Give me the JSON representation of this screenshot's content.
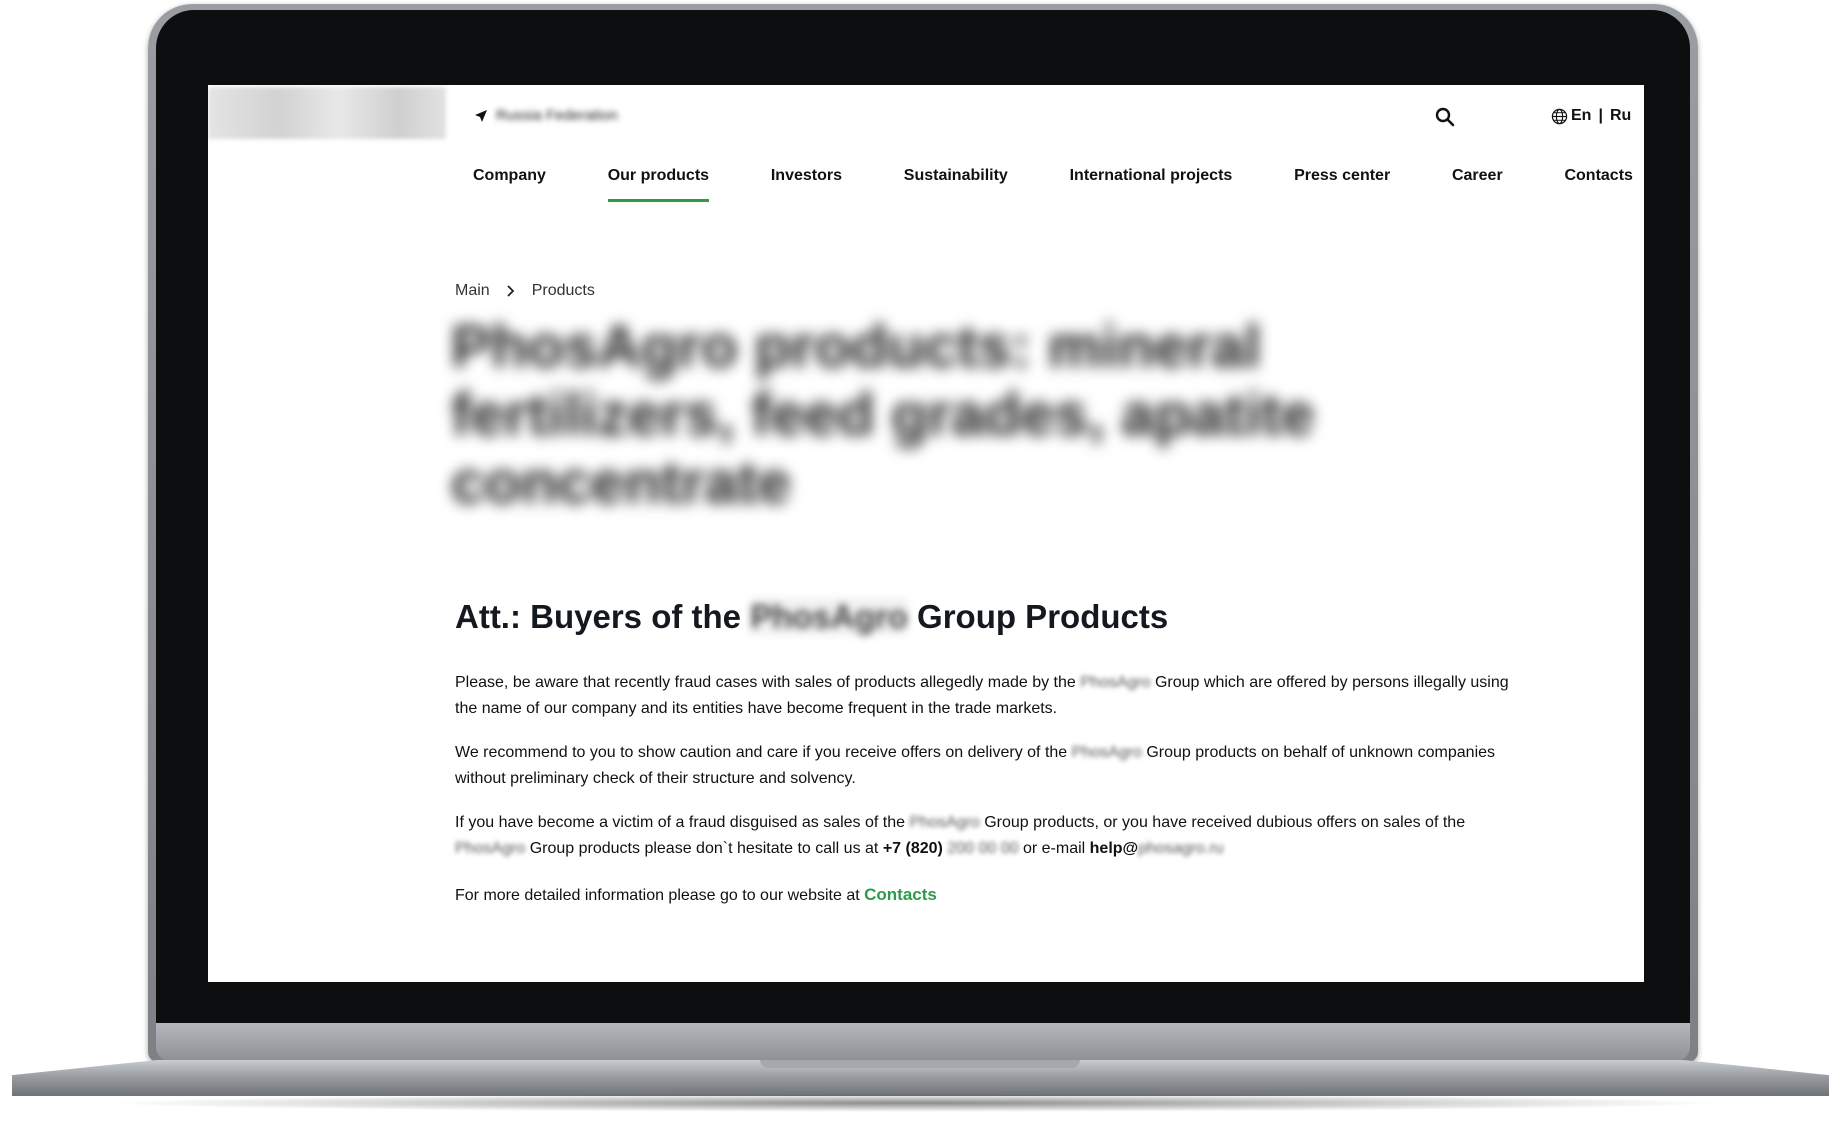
{
  "header": {
    "logo_text": "",
    "location_text": "Russia Federation",
    "lang": {
      "en": "En",
      "separator": "|",
      "ru": "Ru"
    }
  },
  "nav": {
    "items": [
      {
        "label": "Company"
      },
      {
        "label": "Our products"
      },
      {
        "label": "Investors"
      },
      {
        "label": "Sustainability"
      },
      {
        "label": "International projects"
      },
      {
        "label": "Press center"
      },
      {
        "label": "Career"
      },
      {
        "label": "Contacts"
      }
    ],
    "active_index": 1
  },
  "breadcrumb": {
    "items": [
      "Main",
      "Products"
    ]
  },
  "page_title": "PhosAgro products: mineral fertilizers, feed grades, apatite concentrate",
  "notice": {
    "heading_prefix": "Att.: Buyers of the",
    "company": "PhosAgro",
    "heading_suffix": "Group Products",
    "p1_a": "Please, be aware that recently fraud cases with sales of products allegedly made by the",
    "p1_b": "Group which are offered by persons illegally using the name of our company and its entities have become frequent in the trade markets.",
    "p2_a": "We recommend to you to show caution and care if you receive offers on delivery of the",
    "p2_b": "Group products on behalf of unknown companies without preliminary check of their structure and solvency.",
    "p3_a": "If you have become a victim of a fraud disguised as sales of the",
    "p3_b": "Group products, or you have received dubious offers on sales of the",
    "p3_c": "Group products please don`t hesitate to call us at",
    "phone_prefix": "+7 (820)",
    "phone_rest": "200 00 00",
    "p3_d": "or e-mail",
    "email_prefix": "help@",
    "email_rest": "phosagro.ru",
    "p4": "For more detailed information please go to our website at",
    "contacts_link": "Contacts"
  },
  "colors": {
    "accent_green": "#2e9b4a",
    "bezel": "#0d0e10",
    "text": "#111111"
  }
}
